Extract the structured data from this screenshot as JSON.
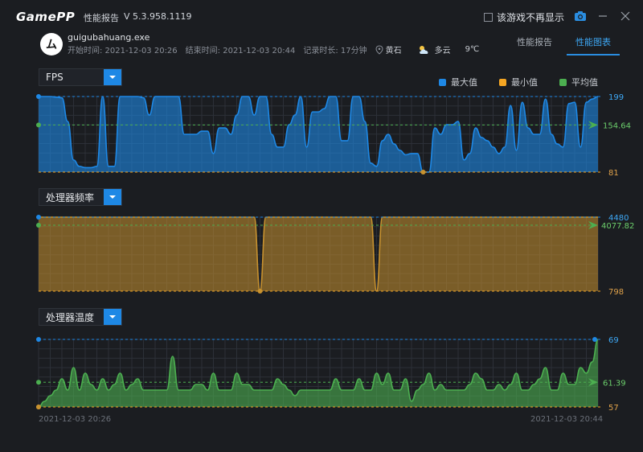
{
  "titlebar": {
    "logo": "GamePP",
    "title": "性能报告",
    "version": "V 5.3.958.1119",
    "dont_show_label": "该游戏不再显示"
  },
  "info": {
    "avatar_text": "ム",
    "exe": "guigubahuang.exe",
    "start_label": "开始时间: 2021-12-03 20:26",
    "end_label": "结束时间: 2021-12-03 20:44",
    "duration_label": "记录时长: 17分钟",
    "location": "黄石",
    "weather": "多云",
    "temperature": "9℃"
  },
  "tabs": [
    {
      "label": "性能报告",
      "active": false
    },
    {
      "label": "性能图表",
      "active": true
    }
  ],
  "legend": [
    {
      "label": "最大值",
      "color": "#1e88e5"
    },
    {
      "label": "最小值",
      "color": "#f5a623"
    },
    {
      "label": "平均值",
      "color": "#4caf50"
    }
  ],
  "time_axis": {
    "start": "2021-12-03 20:26",
    "end": "2021-12-03 20:44"
  },
  "charts": [
    {
      "selector_label": "FPS",
      "max": "199",
      "avg": "154.64",
      "min": "81",
      "color": "#1e88e5",
      "values": [
        199,
        199,
        199,
        198,
        197,
        160,
        100,
        90,
        88,
        88,
        90,
        199,
        90,
        90,
        199,
        199,
        199,
        199,
        197,
        170,
        199,
        199,
        199,
        199,
        199,
        140,
        140,
        140,
        145,
        145,
        110,
        150,
        150,
        140,
        170,
        199,
        199,
        170,
        199,
        199,
        140,
        120,
        120,
        155,
        170,
        199,
        120,
        175,
        175,
        180,
        199,
        199,
        130,
        130,
        199,
        199,
        160,
        95,
        90,
        130,
        140,
        125,
        115,
        108,
        110,
        110,
        81,
        81,
        150,
        140,
        155,
        155,
        160,
        100,
        110,
        150,
        135,
        130,
        120,
        110,
        120,
        185,
        115,
        190,
        150,
        140,
        140,
        195,
        140,
        125,
        120,
        188,
        190,
        120,
        190,
        195,
        199
      ]
    },
    {
      "selector_label": "处理器频率",
      "max": "4480",
      "avg": "4077.82",
      "min": "798",
      "color": "#c8922f",
      "values": [
        4480,
        4480,
        4480,
        4480,
        4480,
        4480,
        4480,
        4480,
        4480,
        4480,
        4480,
        4480,
        4480,
        4480,
        4480,
        4480,
        4480,
        4480,
        4480,
        4480,
        4480,
        4480,
        4480,
        4480,
        4480,
        4480,
        4480,
        4480,
        4480,
        4480,
        4480,
        4480,
        4480,
        4480,
        4480,
        4480,
        4480,
        4480,
        798,
        4480,
        4480,
        4480,
        4480,
        4480,
        4480,
        4480,
        4480,
        4480,
        4480,
        4480,
        4480,
        4480,
        4480,
        4480,
        4480,
        4480,
        4480,
        4480,
        798,
        4480,
        4480,
        4480,
        4480,
        4480,
        4480,
        4480,
        4480,
        4480,
        4480,
        4480,
        4480,
        4480,
        4480,
        4480,
        4480,
        4480,
        4480,
        4480,
        4480,
        4480,
        4480,
        4480,
        4480,
        4480,
        4480,
        4480,
        4480,
        4480,
        4480,
        4480,
        4480,
        4480,
        4480,
        4480,
        4480,
        4480,
        4480
      ]
    },
    {
      "selector_label": "处理器温度",
      "max": "69",
      "avg": "61.39",
      "min": "57",
      "color": "#4caf50",
      "values": [
        57,
        58,
        59,
        60,
        62,
        60,
        64,
        60,
        63,
        61,
        60,
        62,
        60,
        61,
        63,
        60,
        61,
        62,
        60,
        60,
        60,
        60,
        60,
        66,
        60,
        60,
        60,
        61,
        61,
        60,
        63,
        60,
        60,
        60,
        63,
        61,
        61,
        60,
        60,
        60,
        60,
        62,
        61,
        60,
        59,
        60,
        60,
        60,
        60,
        60,
        60,
        62,
        60,
        60,
        60,
        62,
        60,
        60,
        63,
        61,
        63,
        60,
        60,
        62,
        58,
        60,
        61,
        63,
        60,
        61,
        60,
        60,
        60,
        60,
        61,
        63,
        62,
        60,
        60,
        61,
        60,
        61,
        63,
        60,
        60,
        61,
        62,
        64,
        60,
        60,
        63,
        61,
        61,
        64,
        63,
        65,
        69
      ]
    }
  ]
}
